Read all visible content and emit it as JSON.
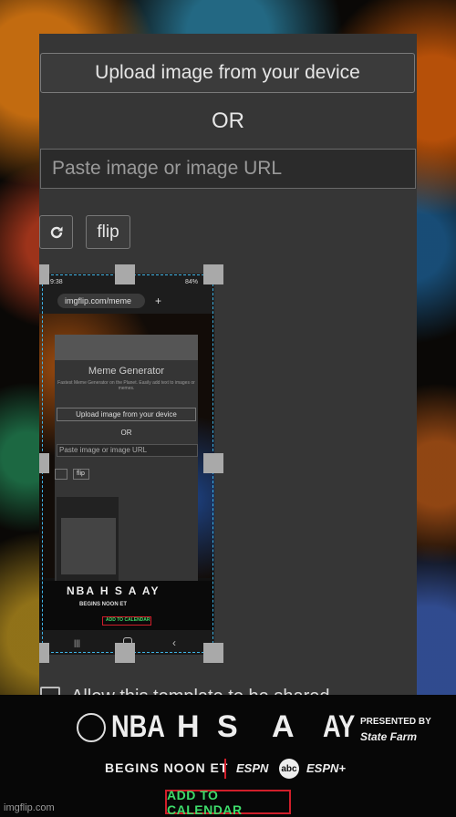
{
  "panel": {
    "upload_label": "Upload image from your device",
    "or_label": "OR",
    "url_placeholder": "Paste image or image URL",
    "rotate_icon": "rotate-icon",
    "flip_label": "flip"
  },
  "preview": {
    "status_time": "9:38",
    "battery": "84%",
    "browser_url": "imgflip.com/meme",
    "page_title": "Meme Generator",
    "page_subtitle": "Fastest Meme Generator on the Planet. Easily add text to images or memes.",
    "upload_label": "Upload image from your device",
    "or_label": "OR",
    "url_placeholder": "Paste image or image URL",
    "flip_label": "flip",
    "ad_letters": "NBA H S A AY",
    "ad_begins": "BEGINS NOON ET",
    "ad_button": "ADD TO CALENDAR"
  },
  "allow_share_label": "Allow this template to be shared",
  "ad": {
    "letters": [
      "NBA",
      "H",
      "S",
      "A",
      "AY"
    ],
    "presented_by": "PRESENTED BY",
    "sponsor": "State Farm",
    "begins": "BEGINS NOON ET",
    "network_1": "ESPN",
    "network_2": "abc",
    "network_3": "ESPN+",
    "cta": "ADD TO CALENDAR"
  },
  "watermark": "imgflip.com",
  "colors": {
    "panel": "#363636",
    "selection": "#3fb4e6",
    "cta_border": "#d01e2a",
    "cta_text": "#3ddc6a"
  }
}
